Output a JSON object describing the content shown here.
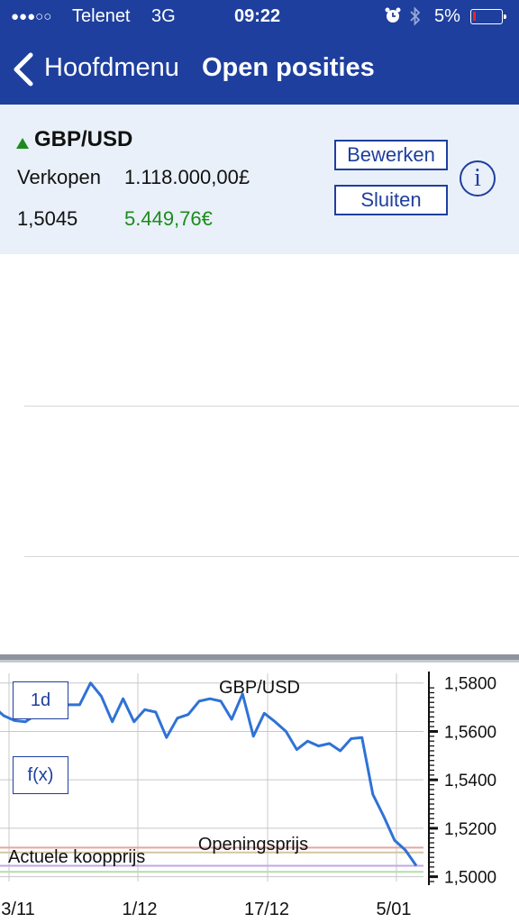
{
  "status_bar": {
    "signal": "●●●○○",
    "carrier": "Telenet",
    "network": "3G",
    "time": "09:22",
    "battery_percent": "5%",
    "icons": [
      "alarm-icon",
      "bluetooth-icon",
      "battery-icon"
    ]
  },
  "nav": {
    "back_label": "Hoofdmenu",
    "title": "Open posities"
  },
  "position": {
    "pair": "GBP/USD",
    "side": "Verkopen",
    "amount": "1.118.000,00£",
    "open_rate": "1,5045",
    "profit": "5.449,76€",
    "edit_button": "Bewerken",
    "close_button": "Sluiten",
    "info_icon": "i"
  },
  "colors": {
    "brand": "#1e3f9e",
    "panel_bg": "#e9f0f9",
    "profit": "#1b8c1b",
    "line": "#2f72d6"
  },
  "chart_controls": {
    "period": "1d",
    "function": "f(x)"
  },
  "chart_data": {
    "type": "line",
    "title": "GBP/USD",
    "x_tick_labels": [
      "3/11",
      "1/12",
      "17/12",
      "5/01"
    ],
    "y_tick_labels": [
      "1,5800",
      "1,5600",
      "1,5400",
      "1,5200",
      "1,5000"
    ],
    "y_ticks": [
      1.58,
      1.56,
      1.54,
      1.52,
      1.5
    ],
    "ylim": [
      1.498,
      1.584
    ],
    "grid": true,
    "annotations": [
      "Openingsprijs",
      "Actuele koopprijs"
    ],
    "series": [
      {
        "values": [
          1.5705,
          1.5665,
          1.5645,
          1.564,
          1.567,
          1.5705,
          1.5695,
          1.571,
          1.571,
          1.58,
          1.5745,
          1.564,
          1.5735,
          1.564,
          1.569,
          1.568,
          1.5575,
          1.5655,
          1.567,
          1.5725,
          1.5735,
          1.5725,
          1.565,
          1.5755,
          1.558,
          1.5675,
          1.564,
          1.56,
          1.5525,
          1.556,
          1.554,
          1.555,
          1.552,
          1.557,
          1.5575,
          1.534,
          1.525,
          1.515,
          1.511,
          1.5045
        ]
      }
    ],
    "reference_lines": [
      {
        "value": 1.512,
        "color": "#e9a3a3"
      },
      {
        "value": 1.51,
        "color": "#cfc8a0"
      },
      {
        "value": 1.5045,
        "color": "#c7a4e6"
      },
      {
        "value": 1.502,
        "color": "#b6dcb0"
      }
    ]
  }
}
